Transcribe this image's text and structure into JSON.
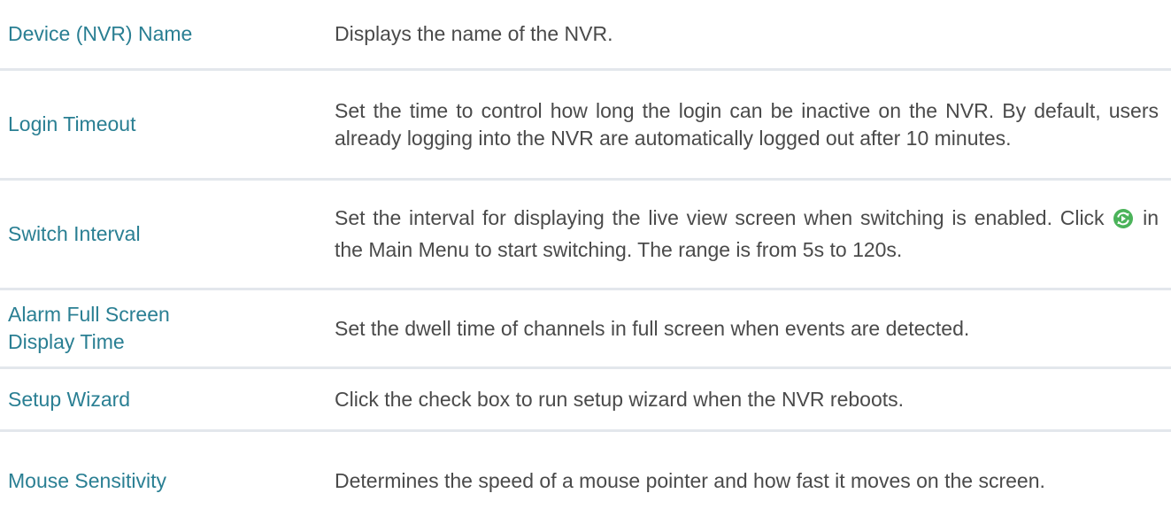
{
  "rows": [
    {
      "term": "Device (NVR) Name",
      "description": "Displays the name of the NVR."
    },
    {
      "term": "Login Timeout",
      "description": "Set the time to control how long the login can be inactive on the NVR. By default, users already logging into the NVR are automatically logged out after 10 minutes."
    },
    {
      "term": "Switch Interval",
      "description_before_icon": "Set the interval for displaying the live view screen when switching is enabled. Click",
      "description_icon": "switching-icon",
      "description_after_icon": " in the Main Menu to start switching. The range is from 5s to 120s."
    },
    {
      "term_line1": "Alarm Full Screen",
      "term_line2": "Display Time",
      "description": "Set the dwell time of channels in full screen when events are detected."
    },
    {
      "term": "Setup Wizard",
      "description": "Click the check box to run setup wizard when the NVR reboots."
    },
    {
      "term": "Mouse Sensitivity",
      "description": "Determines the speed of a mouse pointer and how fast it moves on the screen."
    }
  ],
  "colors": {
    "term": "#2a7f93",
    "description": "#4a4a4a",
    "divider": "#e3e7ec",
    "icon_fill": "#4bb35a"
  }
}
